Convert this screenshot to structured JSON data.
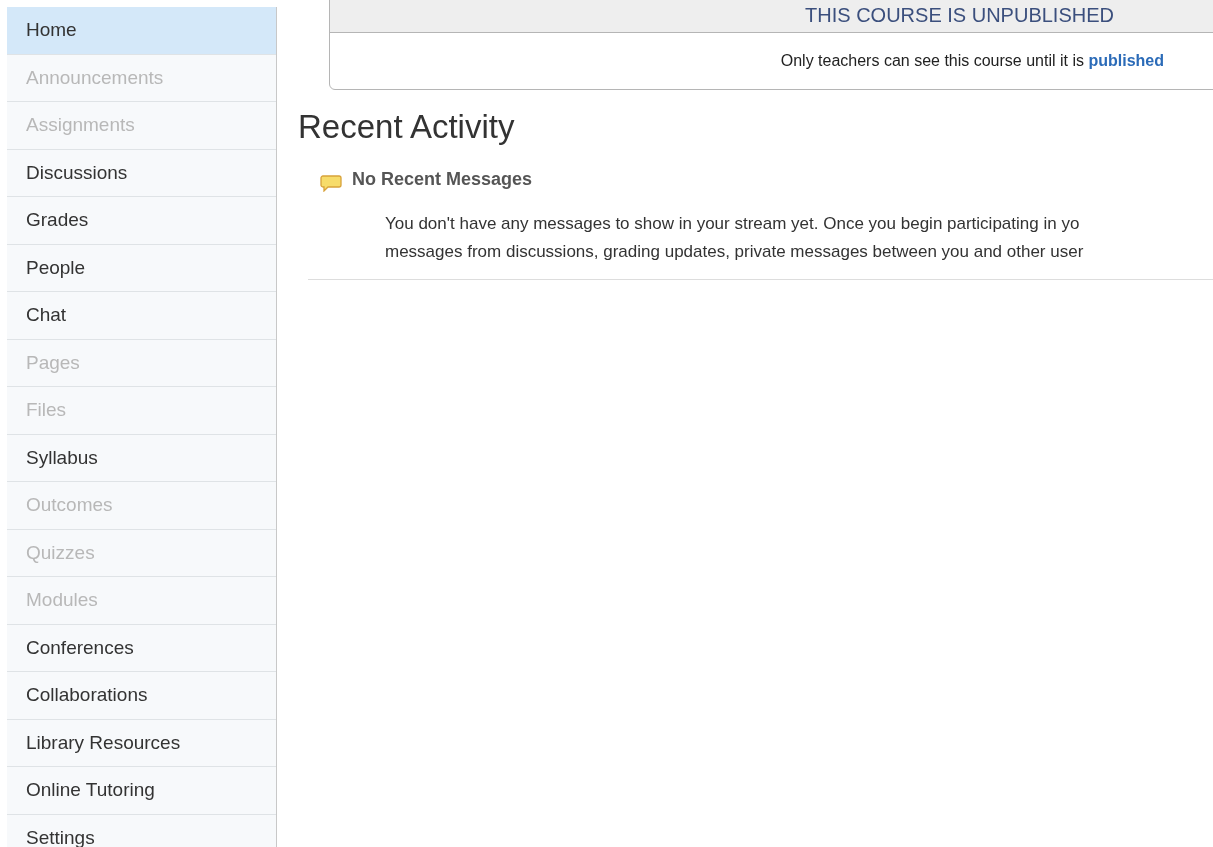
{
  "sidebar": {
    "items": [
      {
        "label": "Home",
        "selected": true,
        "disabled": false
      },
      {
        "label": "Announcements",
        "selected": false,
        "disabled": true
      },
      {
        "label": "Assignments",
        "selected": false,
        "disabled": true
      },
      {
        "label": "Discussions",
        "selected": false,
        "disabled": false
      },
      {
        "label": "Grades",
        "selected": false,
        "disabled": false
      },
      {
        "label": "People",
        "selected": false,
        "disabled": false
      },
      {
        "label": "Chat",
        "selected": false,
        "disabled": false
      },
      {
        "label": "Pages",
        "selected": false,
        "disabled": true
      },
      {
        "label": "Files",
        "selected": false,
        "disabled": true
      },
      {
        "label": "Syllabus",
        "selected": false,
        "disabled": false
      },
      {
        "label": "Outcomes",
        "selected": false,
        "disabled": true
      },
      {
        "label": "Quizzes",
        "selected": false,
        "disabled": true
      },
      {
        "label": "Modules",
        "selected": false,
        "disabled": true
      },
      {
        "label": "Conferences",
        "selected": false,
        "disabled": false
      },
      {
        "label": "Collaborations",
        "selected": false,
        "disabled": false
      },
      {
        "label": "Library Resources",
        "selected": false,
        "disabled": false
      },
      {
        "label": "Online Tutoring",
        "selected": false,
        "disabled": false
      },
      {
        "label": "Settings",
        "selected": false,
        "disabled": false
      }
    ]
  },
  "banner": {
    "title": "THIS COURSE IS UNPUBLISHED",
    "message": "Only teachers can see this course until it is",
    "link": "published"
  },
  "heading": "Recent Activity",
  "stream": {
    "title": "No Recent Messages",
    "lines": [
      "You don't have any messages to show in your stream yet. Once you begin participating in yo",
      "messages from discussions, grading updates, private messages between you and other user"
    ]
  }
}
